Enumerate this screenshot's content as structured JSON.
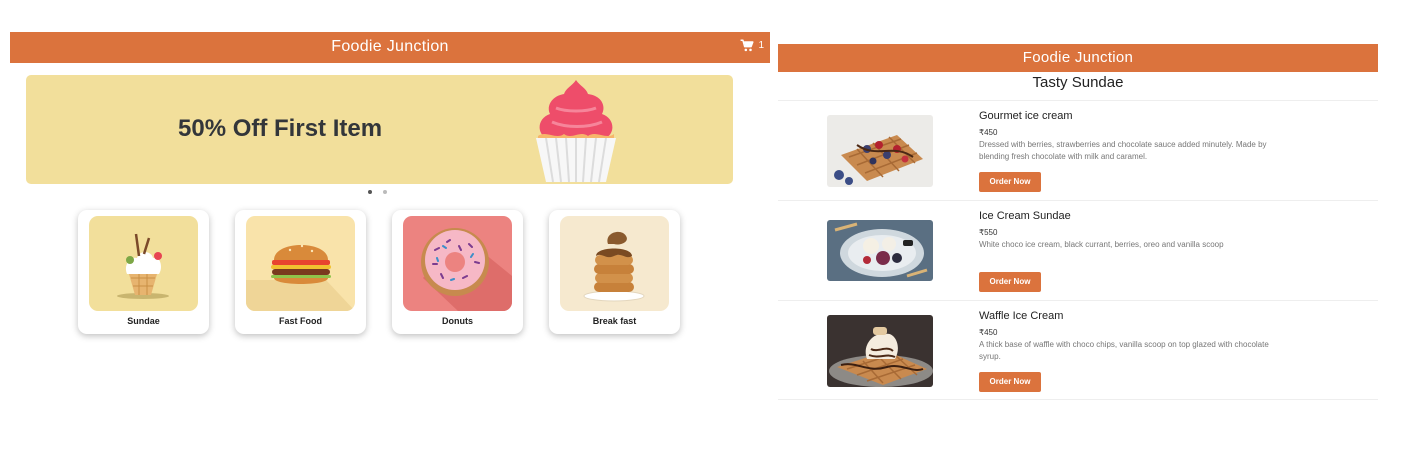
{
  "left_screen": {
    "header": {
      "title": "Foodie Junction",
      "cart_count": "1"
    },
    "banner": {
      "headline": "50% Off First Item",
      "slides": 2,
      "active_slide": 1
    },
    "categories": [
      {
        "label": "Sundae",
        "icon": "sundae-icon",
        "bg": "#f2df9b"
      },
      {
        "label": "Fast Food",
        "icon": "burger-icon",
        "bg": "#f9e3aa"
      },
      {
        "label": "Donuts",
        "icon": "donut-icon",
        "bg": "#ec8380"
      },
      {
        "label": "Break fast",
        "icon": "pancakes-icon",
        "bg": "#f6e9cf"
      }
    ]
  },
  "right_screen": {
    "header": {
      "title": "Foodie Junction"
    },
    "section_title": "Tasty Sundae",
    "items": [
      {
        "name": "Gourmet ice cream",
        "price": "₹450",
        "description": "Dressed with berries, strawberries and chocolate sauce added minutely. Made by blending fresh chocolate with milk and caramel.",
        "button": "Order Now"
      },
      {
        "name": "Ice Cream Sundae",
        "price": "₹550",
        "description": "White choco ice cream, black currant, berries, oreo and vanilla scoop",
        "button": "Order Now"
      },
      {
        "name": "Waffle Ice Cream",
        "price": "₹450",
        "description": "A thick base of waffle with choco chips, vanilla scoop on top glazed with chocolate syrup.",
        "button": "Order Now"
      }
    ]
  },
  "colors": {
    "brand": "#db733d",
    "banner": "#f2df9b"
  }
}
